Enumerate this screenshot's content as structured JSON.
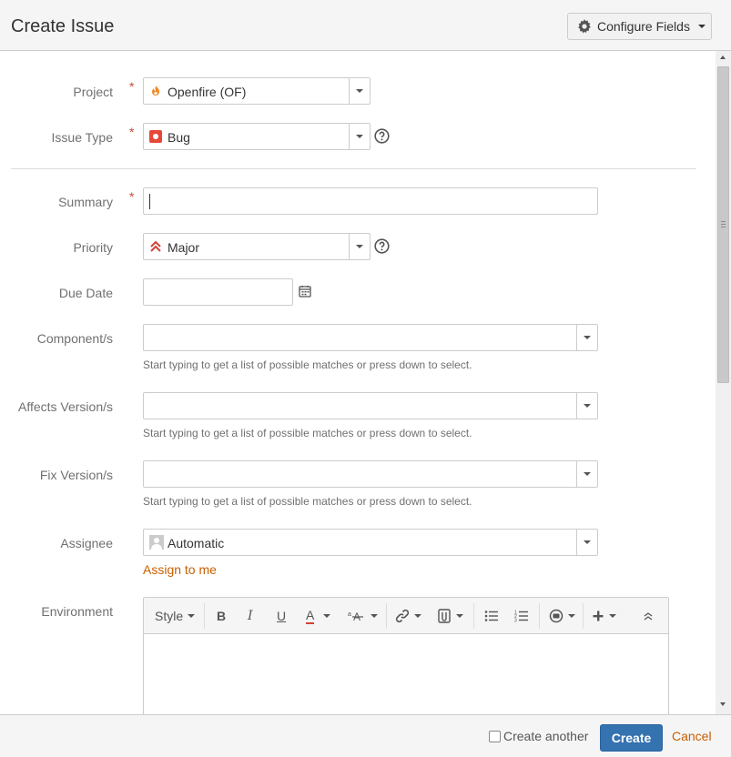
{
  "header": {
    "title": "Create Issue",
    "configure_fields": "Configure Fields"
  },
  "form": {
    "project": {
      "label": "Project",
      "required_mark": "*",
      "value": "Openfire (OF)",
      "icon": "openfire-icon"
    },
    "issue_type": {
      "label": "Issue Type",
      "required_mark": "*",
      "value": "Bug",
      "icon": "bug-icon"
    },
    "summary": {
      "label": "Summary",
      "required_mark": "*",
      "value": ""
    },
    "priority": {
      "label": "Priority",
      "value": "Major",
      "icon": "priority-major-icon"
    },
    "due_date": {
      "label": "Due Date",
      "value": ""
    },
    "components": {
      "label": "Component/s",
      "value": "",
      "hint": "Start typing to get a list of possible matches or press down to select."
    },
    "affects_versions": {
      "label": "Affects Version/s",
      "value": "",
      "hint": "Start typing to get a list of possible matches or press down to select."
    },
    "fix_versions": {
      "label": "Fix Version/s",
      "value": "",
      "hint": "Start typing to get a list of possible matches or press down to select."
    },
    "assignee": {
      "label": "Assignee",
      "value": "Automatic",
      "assign_to_me": "Assign to me"
    },
    "environment": {
      "label": "Environment",
      "toolbar": {
        "style": "Style"
      }
    }
  },
  "footer": {
    "create_another": "Create another",
    "create": "Create",
    "cancel": "Cancel"
  },
  "colors": {
    "primary": "#3572b0",
    "link": "#c75f00",
    "required": "#d04437",
    "bug": "#e5493a"
  }
}
